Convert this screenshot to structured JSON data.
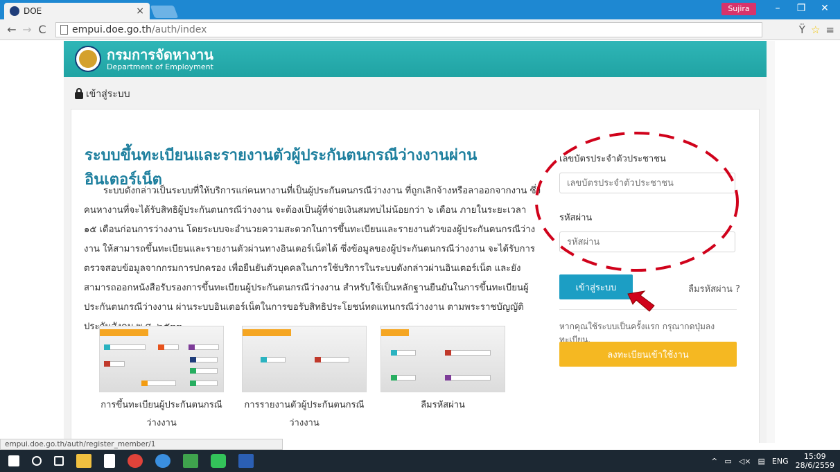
{
  "browser": {
    "tab_title": "DOE",
    "tab_close": "×",
    "user_name": "Sujira",
    "url_host": "empui.doe.go.th",
    "url_path": "/auth/index",
    "status_url": "empui.doe.go.th/auth/register_member/1"
  },
  "site": {
    "brand_th": "กรมการจัดหางาน",
    "brand_en": "Department of Employment",
    "breadcrumb": "เข้าสู่ระบบ"
  },
  "main": {
    "title": "ระบบขึ้นทะเบียนและรายงานตัวผู้ประกันตนกรณีว่างงานผ่านอินเตอร์เน็ต",
    "description": "ระบบดังกล่าวเป็นระบบที่ให้บริการแก่คนหางานที่เป็นผู้ประกันตนกรณีว่างงาน ที่ถูกเลิกจ้างหรือลาออกจากงาน ซึ่งคนหางานที่จะได้รับสิทธิผู้ประกันตนกรณีว่างงาน จะต้องเป็นผู้ที่จ่ายเงินสมทบไม่น้อยกว่า ๖ เดือน ภายในระยะเวลา ๑๕ เดือนก่อนการว่างงาน โดยระบบจะอำนวยความสะดวกในการขึ้นทะเบียนและรายงานตัวของผู้ประกันตนกรณีว่างงาน ให้สามารถขึ้นทะเบียนและรายงานตัวผ่านทางอินเตอร์เน็ตได้ ซึ่งข้อมูลของผู้ประกันตนกรณีว่างงาน จะได้รับการตรวจสอบข้อมูลจากกรมการปกครอง เพื่อยืนยันตัวบุคคลในการใช้บริการในระบบดังกล่าวผ่านอินเตอร์เน็ต และยังสามารถออกหนังสือรับรองการขึ้นทะเบียนผู้ประกันตนกรณีว่างงาน สำหรับใช้เป็นหลักฐานยืนยันในการขึ้นทะเบียนผู้ประกันตนกรณีว่างงาน ผ่านระบบอินเตอร์เน็ตในการขอรับสิทธิประโยชน์ทดแทนกรณีว่างงาน ตามพระราชบัญญัติประกันสังคม พ.ศ. ๒๕๓๓",
    "thumbnails": [
      {
        "caption": "การขึ้นทะเบียนผู้ประกันตนกรณีว่างงาน"
      },
      {
        "caption": "การรายงานตัวผู้ประกันตนกรณีว่างงาน"
      },
      {
        "caption": "ลืมรหัสผ่าน"
      }
    ]
  },
  "login": {
    "id_label": "เลขบัตรประจำตัวประชาชน",
    "id_placeholder": "เลขบัตรประจำตัวประชาชน",
    "password_label": "รหัสผ่าน",
    "password_placeholder": "รหัสผ่าน",
    "login_button": "เข้าสู่ระบบ",
    "forgot_link": "ลืมรหัสผ่าน ?",
    "first_time_hint": "หากคุณใช้ระบบเป็นครั้งแรก กรุณากดปุ่มลงทะเบียน.",
    "register_button": "ลงทะเบียนเข้าใช้งาน"
  },
  "taskbar": {
    "language": "ENG",
    "time": "15:09",
    "date": "28/6/2559"
  },
  "colors": {
    "header_teal": "#20a3a3",
    "title_blue": "#1d7f9e",
    "login_button": "#1c9ec4",
    "register_button": "#f5b822",
    "annotation_red": "#d0021b"
  }
}
